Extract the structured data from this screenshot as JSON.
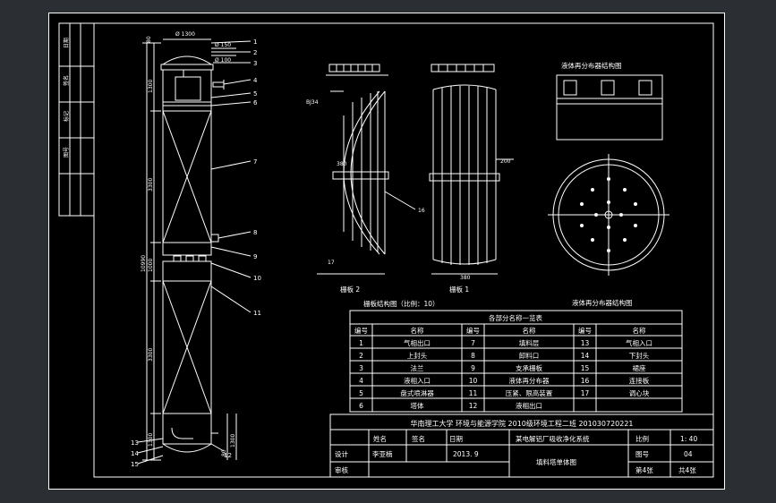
{
  "drawing": {
    "tower": {
      "dims": {
        "d_top": "Ø 1300",
        "d_mid1": "Ø 150",
        "d_mid2": "Ø 100",
        "top_h": "80",
        "seg1": "1300",
        "seg2": "3300",
        "seg3": "1000",
        "seg4": "3300",
        "total": "10990",
        "bottom": "1300",
        "base1": "1300",
        "base2": "80"
      },
      "callouts": [
        "1",
        "2",
        "3",
        "4",
        "5",
        "6",
        "7",
        "8",
        "9",
        "10",
        "11",
        "12",
        "13",
        "14",
        "15"
      ]
    },
    "grid_plate": {
      "dim_top": "380",
      "dim_side1": "200",
      "dim_side2": "380",
      "label_left_callout": "BJ34",
      "callout_16": "16",
      "callout_17": "17",
      "label_plate2": "栅板 2",
      "label_plate1": "栅板 1",
      "caption": "栅板结构图（比例：10）"
    },
    "distributor": {
      "title_top": "液体再分布器结构图",
      "caption": "液体再分布器结构图"
    }
  },
  "parts_table": {
    "title": "各部分名称一览表",
    "headers": [
      "编号",
      "名称",
      "编号",
      "名称",
      "编号",
      "名称"
    ],
    "rows": [
      [
        "1",
        "气相出口",
        "7",
        "填料层",
        "13",
        "气相入口"
      ],
      [
        "2",
        "上封头",
        "8",
        "卸料口",
        "14",
        "下封头"
      ],
      [
        "3",
        "法兰",
        "9",
        "支承栅板",
        "15",
        "裙座"
      ],
      [
        "4",
        "液相入口",
        "10",
        "液体再分布器",
        "16",
        "连接板"
      ],
      [
        "5",
        "盘式喷淋器",
        "11",
        "压紧、限高装置",
        "17",
        "调心块"
      ],
      [
        "6",
        "塔体",
        "12",
        "液相出口",
        "",
        ""
      ]
    ]
  },
  "title_block": {
    "school": "华南理工大学 环境与能源学院 2010级环境工程二班 201030720221",
    "h_name": "姓名",
    "h_sign": "签名",
    "h_date": "日期",
    "project": "某电解铝厂吸收净化系统",
    "scale_label": "比例",
    "scale_value": "1: 40",
    "design_label": "设计",
    "designer": "李亚楠",
    "date": "2013. 9",
    "drawing_no_label": "图号",
    "drawing_no": "04",
    "drawing_title": "填料塔单体图",
    "review_label": "审核",
    "sheet_no": "第4张",
    "sheet_total": "共4张"
  },
  "side_strip": [
    "日期",
    "签名",
    "标记",
    "图号"
  ],
  "colors": {
    "background": "#000000",
    "line": "#ffffff",
    "frame_bg": "#2b2f33"
  }
}
